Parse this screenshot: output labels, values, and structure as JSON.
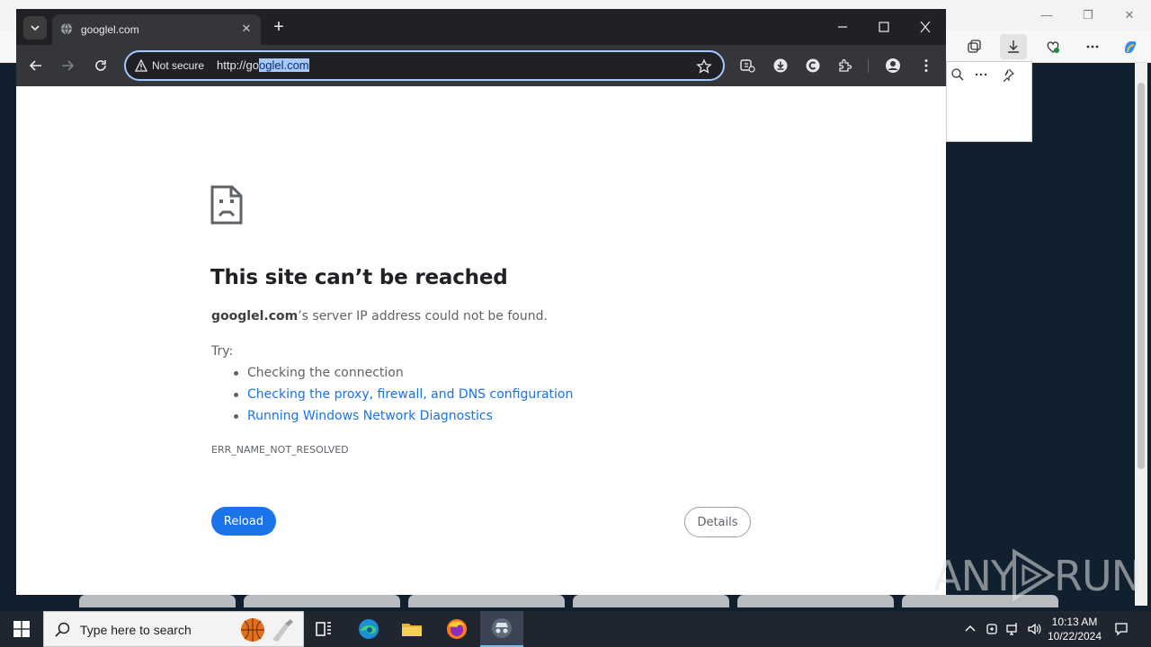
{
  "chrome": {
    "tab_title": "googlel.com",
    "omnibox": {
      "security_label": "Not secure",
      "url_prefix": "http://go",
      "url_selected": "oglel.com"
    }
  },
  "error_page": {
    "title": "This site can’t be reached",
    "host": "googlel.com",
    "description_suffix": "’s server IP address could not be found.",
    "try_label": "Try:",
    "suggestions": [
      "Checking the connection",
      "Checking the proxy, firewall, and DNS configuration",
      "Running Windows Network Diagnostics"
    ],
    "error_code": "ERR_NAME_NOT_RESOLVED",
    "reload_label": "Reload",
    "details_label": "Details"
  },
  "watermark": {
    "text_left": "ANY",
    "text_right": "RUN"
  },
  "taskbar": {
    "search_placeholder": "Type here to search",
    "time": "10:13 AM",
    "date": "10/22/2024"
  },
  "colors": {
    "accent": "#1a73e8",
    "chrome_dark": "#202124",
    "chrome_toolbar": "#35363a",
    "omnibox_focus": "#a8c7fa",
    "taskbar": "#1f2630"
  }
}
